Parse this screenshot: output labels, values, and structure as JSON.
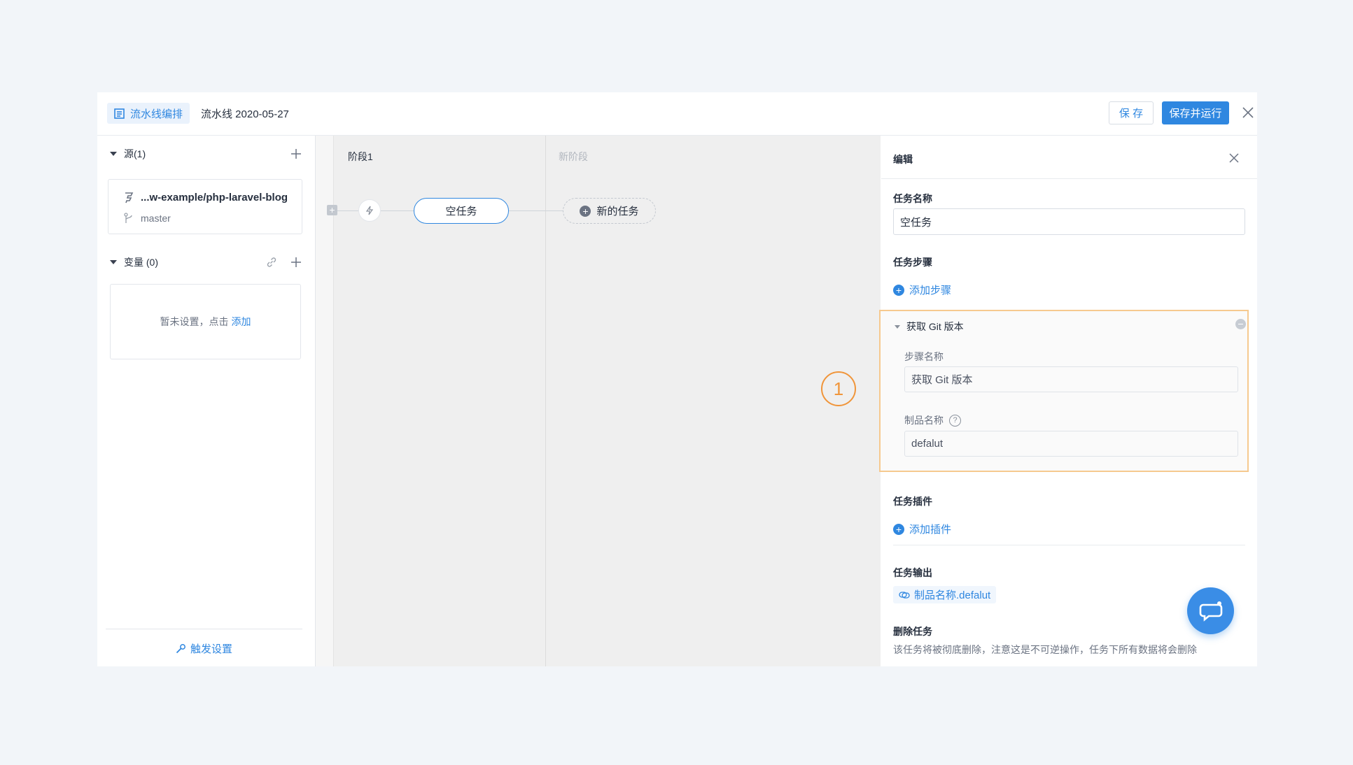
{
  "header": {
    "editor_tab": "流水线编排",
    "pipeline_name": "流水线 2020-05-27",
    "save_label": "保 存",
    "save_run_label": "保存并运行"
  },
  "sidebar": {
    "source_title": "源(1)",
    "repo_name": "...w-example/php-laravel-blog",
    "branch": "master",
    "variables_title": "变量 (0)",
    "variables_empty": "暂未设置，点击",
    "variables_add": "添加",
    "trigger_settings": "触发设置"
  },
  "canvas": {
    "stage1_label": "阶段1",
    "new_stage_label": "新阶段",
    "task_label": "空任务",
    "new_task_label": "新的任务",
    "annotation": "1"
  },
  "panel": {
    "title": "编辑",
    "task_name_label": "任务名称",
    "task_name_value": "空任务",
    "task_steps_label": "任务步骤",
    "add_step": "添加步骤",
    "step": {
      "title": "获取 Git 版本",
      "step_name_label": "步骤名称",
      "step_name_value": "获取 Git 版本",
      "artifact_label": "制品名称",
      "artifact_value": "defalut"
    },
    "plugins_label": "任务插件",
    "add_plugin": "添加插件",
    "output_label": "任务输出",
    "output_value": "制品名称.defalut",
    "delete_label": "删除任务",
    "delete_desc": "该任务将被彻底删除，注意这是不可逆操作，任务下所有数据将会删除"
  },
  "colors": {
    "accent": "#2f87e0",
    "annotation": "#f0953a"
  }
}
